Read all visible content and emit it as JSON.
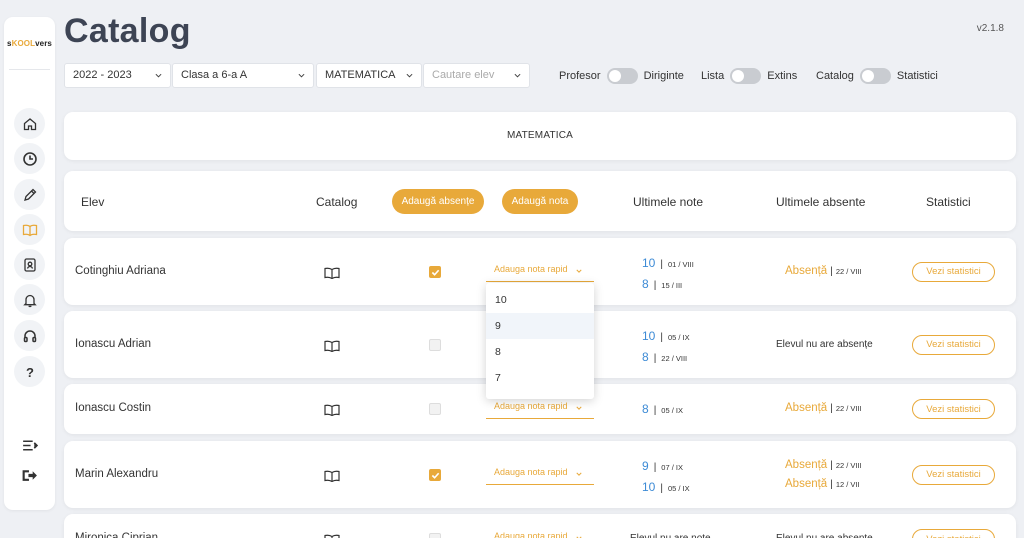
{
  "app": {
    "title": "Catalog",
    "version": "v2.1.8",
    "logo": {
      "part1": "s",
      "part2": "KOOL",
      "part3": "vers"
    }
  },
  "filters": {
    "year": "2022 - 2023",
    "class": "Clasa a 6-a A",
    "subject": "MATEMATICA",
    "student_placeholder": "Cautare elev"
  },
  "toggles": [
    {
      "left": "Profesor",
      "right": "Diriginte"
    },
    {
      "left": "Lista",
      "right": "Extins"
    },
    {
      "left": "Catalog",
      "right": "Statistici"
    }
  ],
  "subject_title": "MATEMATICA",
  "table": {
    "col_student": "Elev",
    "col_catalog": "Catalog",
    "add_absence": "Adaugă absențe",
    "add_grade": "Adaugă nota",
    "col_last_grades": "Ultimele note",
    "col_last_absences": "Ultimele absente",
    "col_stats": "Statistici"
  },
  "quick_grade_label": "Adauga nota rapid",
  "stats_button": "Vezi statistici",
  "absence_word": "Absență",
  "no_absences": "Elevul nu are absențe",
  "no_grades": "Elevul nu are note",
  "dropdown_options": [
    "10",
    "9",
    "8",
    "7"
  ],
  "rows": [
    {
      "name": "Cotinghiu Adriana",
      "checked": true,
      "grades": [
        {
          "g": "10",
          "d": "01 / VIII"
        },
        {
          "g": "8",
          "d": "15 / III"
        }
      ],
      "absences": [
        {
          "d": "22 / VIII"
        }
      ]
    },
    {
      "name": "Ionascu Adrian",
      "checked": false,
      "grades": [
        {
          "g": "10",
          "d": "05 / IX"
        },
        {
          "g": "8",
          "d": "22 / VIII"
        }
      ],
      "absences": []
    },
    {
      "name": "Ionascu Costin",
      "checked": false,
      "grades": [
        {
          "g": "8",
          "d": "05 / IX"
        }
      ],
      "absences": [
        {
          "d": "22 / VIII"
        }
      ]
    },
    {
      "name": "Marin Alexandru",
      "checked": true,
      "grades": [
        {
          "g": "9",
          "d": "07 / IX"
        },
        {
          "g": "10",
          "d": "05 / IX"
        }
      ],
      "absences": [
        {
          "d": "22 / VIII"
        },
        {
          "d": "12 / VII"
        }
      ]
    },
    {
      "name": "Mironica Ciprian",
      "checked": false,
      "grades": [],
      "absences": []
    }
  ],
  "colors": {
    "accent": "#e8a93a",
    "grade": "#3d8bd6",
    "title": "#3d4454"
  }
}
